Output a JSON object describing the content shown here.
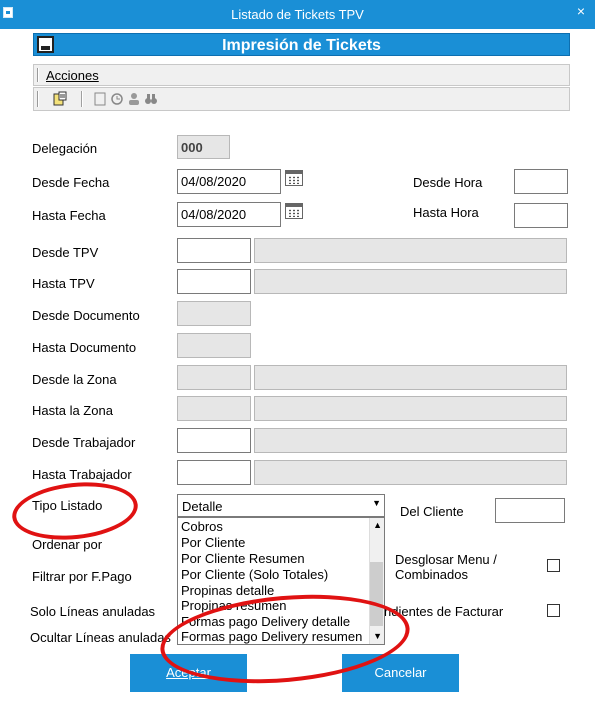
{
  "window": {
    "title": "Listado de Tickets TPV",
    "close_label": "×"
  },
  "header": {
    "title": "Impresión de Tickets"
  },
  "menu": {
    "acciones": "Acciones"
  },
  "form": {
    "delegacion": {
      "label": "Delegación",
      "value": "000"
    },
    "desde_fecha": {
      "label": "Desde Fecha",
      "value": "04/08/2020"
    },
    "hasta_fecha": {
      "label": "Hasta Fecha",
      "value": "04/08/2020"
    },
    "desde_hora": {
      "label": "Desde Hora",
      "value": ""
    },
    "hasta_hora": {
      "label": "Hasta Hora",
      "value": ""
    },
    "desde_tpv": "Desde TPV",
    "hasta_tpv": "Hasta TPV",
    "desde_documento": "Desde Documento",
    "hasta_documento": "Hasta Documento",
    "desde_zona": "Desde la Zona",
    "hasta_zona": "Hasta la Zona",
    "desde_trabajador": "Desde Trabajador",
    "hasta_trabajador": "Hasta Trabajador",
    "tipo_listado": {
      "label": "Tipo Listado",
      "selected": "Detalle"
    },
    "del_cliente": "Del Cliente",
    "ordenar_por": "Ordenar por",
    "filtrar_por_fpago": "Filtrar por F.Pago",
    "desglosar_menu": [
      "Desglosar Menu /",
      "Combinados"
    ],
    "solo_lineas_anuladas": "Solo Líneas anuladas",
    "pendientes_facturar": "ndientes de Facturar",
    "ocultar_lineas_anuladas": "Ocultar Líneas anuladas"
  },
  "dropdown_options": [
    "Cobros",
    "Por Cliente",
    "Por Cliente Resumen",
    "Por Cliente (Solo Totales)",
    "Propinas detalle",
    "Propinas resumen",
    "Formas pago Delivery detalle",
    "Formas pago Delivery resumen"
  ],
  "buttons": {
    "aceptar": "Aceptar",
    "cancelar": "Cancelar"
  },
  "colors": {
    "accent": "#1a8fd6",
    "annotation": "#e01212"
  }
}
